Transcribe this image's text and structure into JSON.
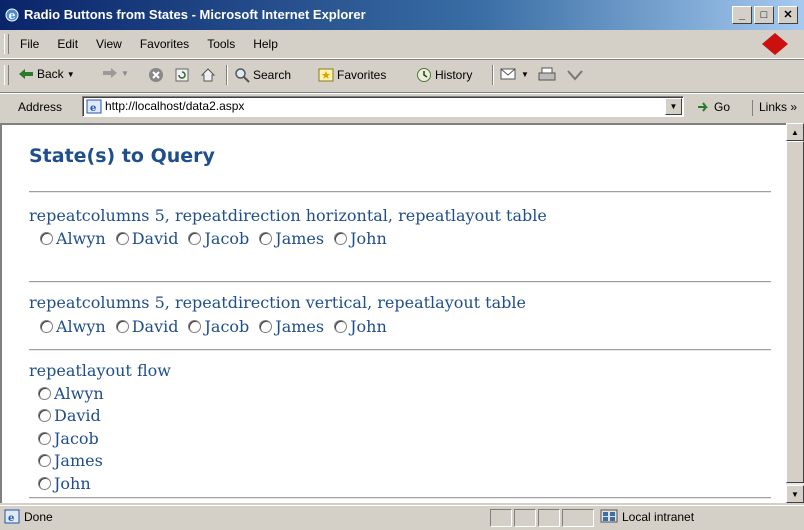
{
  "window": {
    "title": "Radio Buttons from States - Microsoft Internet Explorer",
    "min_label": "_",
    "max_label": "□",
    "close_label": "✕"
  },
  "menu": {
    "items": [
      "File",
      "Edit",
      "View",
      "Favorites",
      "Tools",
      "Help"
    ]
  },
  "toolbar": {
    "back": "Back",
    "search": "Search",
    "favorites": "Favorites",
    "history": "History"
  },
  "address": {
    "label": "Address",
    "url": "http://localhost/data2.aspx",
    "go": "Go",
    "links": "Links »"
  },
  "page": {
    "title": "State(s) to Query",
    "sections": [
      {
        "label": "repeatcolumns 5, repeatdirection horizontal, repeatlayout table",
        "options": [
          "Alwyn",
          "David",
          "Jacob",
          "James",
          "John"
        ]
      },
      {
        "label": "repeatcolumns 5, repeatdirection vertical, repeatlayout table",
        "options": [
          "Alwyn",
          "David",
          "Jacob",
          "James",
          "John"
        ]
      },
      {
        "label": "repeatlayout flow",
        "options": [
          "Alwyn",
          "David",
          "Jacob",
          "James",
          "John"
        ]
      }
    ]
  },
  "status": {
    "text": "Done",
    "zone": "Local intranet"
  },
  "colors": {
    "link_text": "#1f4e8c",
    "title_bar": "#0a246a"
  }
}
